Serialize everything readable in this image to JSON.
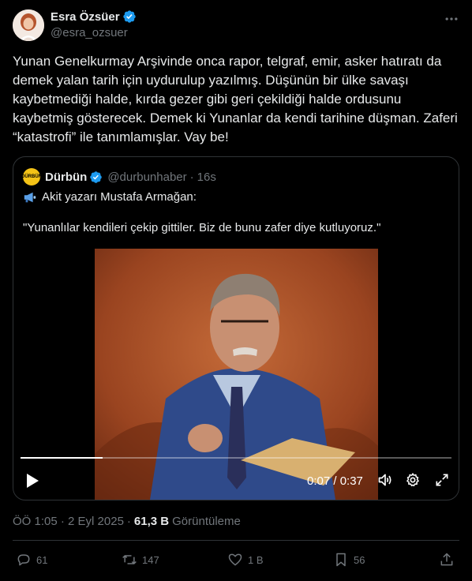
{
  "author": {
    "name": "Esra Özsüer",
    "handle": "@esra_ozsuer"
  },
  "tweet_text": "Yunan Genelkurmay Arşivinde onca rapor, telgraf, emir, asker hatıratı da demek yalan tarih için uydurulup yazılmış. Düşünün bir ülke savaşı kaybetmediği halde, kırda gezer gibi geri çekildiği halde ordusunu kaybetmiş gösterecek. Demek ki Yunanlar da kendi tarihine düşman. Zaferi “katastrofi” ile tanımlamışlar. Vay be!",
  "quoted": {
    "avatar_text": "DÜRBÜN",
    "name": "Dürbün",
    "handle": "@durbunhaber",
    "separator": "·",
    "time": "16s",
    "line1": "Akit yazarı Mustafa Armağan:",
    "line2": "\"Yunanlılar kendileri çekip gittiler. Biz de bunu zafer diye kutluyoruz.\"",
    "video": {
      "current_time": "0:07",
      "duration": "0:37",
      "time_display": "0:07 / 0:37",
      "progress": 0.19
    }
  },
  "meta": {
    "timestamp": "ÖÖ 1:05 · 2 Eyl 2025",
    "separator": "·",
    "views_count": "61,3 B",
    "views_label": "Görüntüleme"
  },
  "actions": {
    "replies": "61",
    "reposts": "147",
    "likes": "1 B",
    "bookmarks": "56"
  },
  "colors": {
    "background": "#000000",
    "text": "#e7e9ea",
    "secondary": "#71767b",
    "border": "#2f3336",
    "verified": "#1d9bf0",
    "durbun_yellow": "#f4c317"
  }
}
